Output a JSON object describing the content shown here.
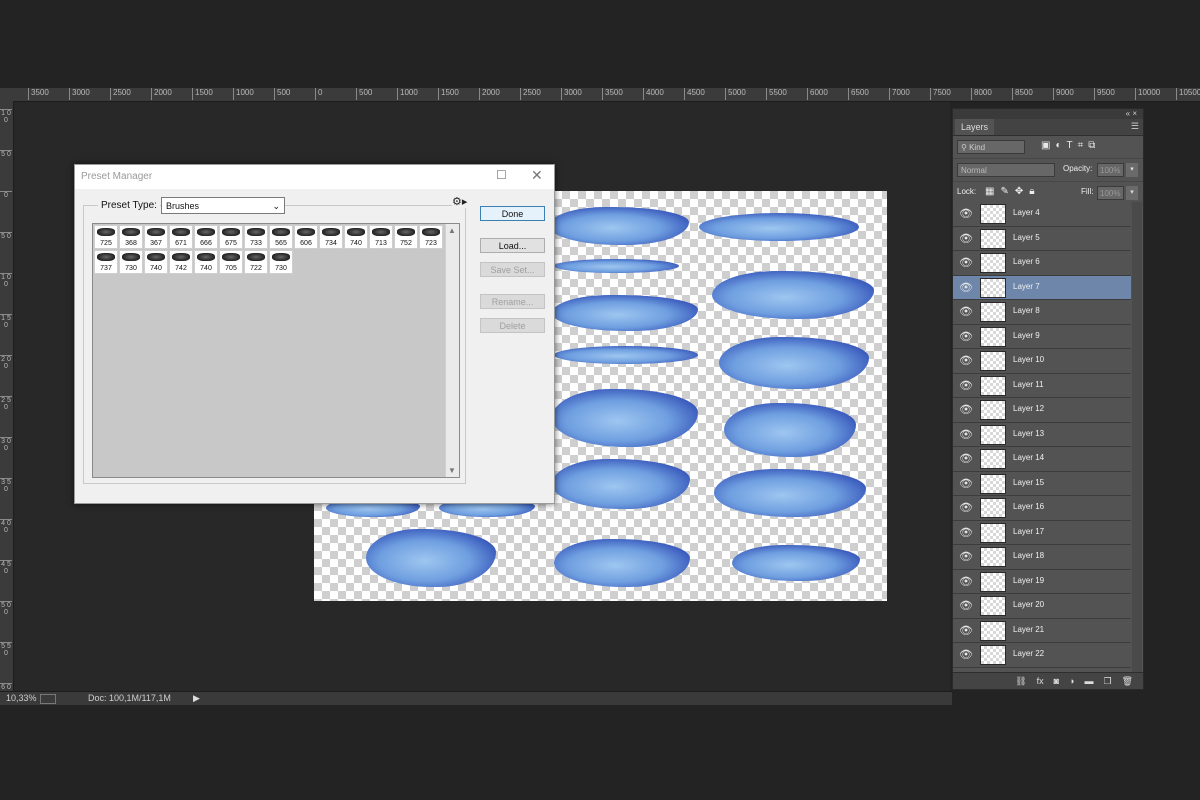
{
  "ruler": {
    "top_labels": [
      "3500",
      "3000",
      "2500",
      "2000",
      "1500",
      "1000",
      "500",
      "0",
      "500",
      "1000",
      "1500",
      "2000",
      "2500",
      "3000",
      "3500",
      "4000",
      "4500",
      "5000",
      "5500",
      "6000",
      "6500",
      "7000",
      "7500",
      "8000",
      "8500",
      "9000",
      "9500",
      "10000",
      "10500"
    ],
    "left_labels": [
      "1 0 0",
      "5 0",
      "0",
      "5 0",
      "1 0 0",
      "1 5 0",
      "2 0 0",
      "2 5 0",
      "3 0 0",
      "3 5 0",
      "4 0 0",
      "4 5 0",
      "5 0 0",
      "5 5 0",
      "6 0 0"
    ]
  },
  "status": {
    "zoom": "10,33%",
    "doc": "Doc: 100,1M/117,1M"
  },
  "dialog": {
    "title": "Preset Manager",
    "preset_type_label": "Preset Type:",
    "preset_type_value": "Brushes",
    "buttons": {
      "done": "Done",
      "load": "Load...",
      "save_set": "Save Set...",
      "rename": "Rename...",
      "delete": "Delete"
    },
    "brushes_row1": [
      "725",
      "368",
      "367",
      "671",
      "666",
      "675",
      "733",
      "565",
      "606",
      "734",
      "740",
      "713",
      "752",
      "723"
    ],
    "brushes_row2": [
      "737",
      "730",
      "740",
      "742",
      "740",
      "705",
      "722",
      "730"
    ]
  },
  "layers_panel": {
    "tab": "Layers",
    "kind_filter": "Kind",
    "blend_mode": "Normal",
    "opacity_label": "Opacity:",
    "opacity_value": "100%",
    "lock_label": "Lock:",
    "fill_label": "Fill:",
    "fill_value": "100%",
    "layers": [
      "Layer 4",
      "Layer 5",
      "Layer 6",
      "Layer 7",
      "Layer 8",
      "Layer 9",
      "Layer 10",
      "Layer 11",
      "Layer 12",
      "Layer 13",
      "Layer 14",
      "Layer 15",
      "Layer 16",
      "Layer 17",
      "Layer 18",
      "Layer 19",
      "Layer 20",
      "Layer 21",
      "Layer 22"
    ],
    "selected_layer": "Layer 7",
    "bottom_icons": [
      "link-icon",
      "fx-icon",
      "mask-icon",
      "adjustment-icon",
      "folder-icon",
      "new-layer-icon",
      "trash-icon"
    ]
  },
  "colors": {
    "workspace": "#282828",
    "panel": "#535353",
    "selected_layer": "#6d86a9",
    "stroke_blue": "#3a5bbd"
  }
}
